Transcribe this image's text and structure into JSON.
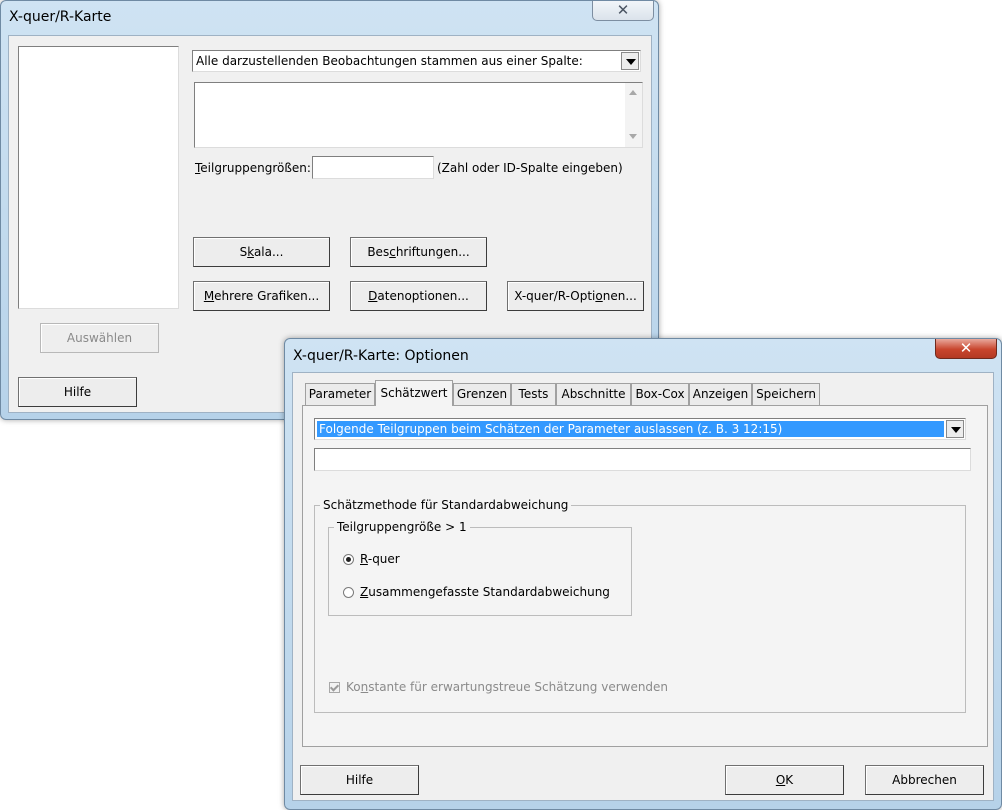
{
  "main_dialog": {
    "title": "X-quer/R-Karte",
    "close_glyph": "✕",
    "data_layout_selected": "Alle darzustellenden Beobachtungen stammen aus einer Spalte:",
    "subgroup_label_first": "T",
    "subgroup_label_rest": "eilgruppengrößen:",
    "subgroup_value": "",
    "subgroup_hint": "(Zahl oder ID-Spalte eingeben)",
    "buttons": {
      "scale_pre": "S",
      "scale_u": "k",
      "scale_post": "ala...",
      "labels_pre": "Bes",
      "labels_u": "c",
      "labels_post": "hriftungen...",
      "multi_pre": "",
      "multi_u": "M",
      "multi_post": "ehrere Grafiken...",
      "dataopt_pre": "",
      "dataopt_u": "D",
      "dataopt_post": "atenoptionen...",
      "xr_pre": "X-quer/R-Opti",
      "xr_u": "o",
      "xr_post": "nen...",
      "select": "Auswählen",
      "help": "Hilfe"
    }
  },
  "options_dialog": {
    "title": "X-quer/R-Karte: Optionen",
    "close_glyph": "✕",
    "tabs": [
      "Parameter",
      "Schätzwert",
      "Grenzen",
      "Tests",
      "Abschnitte",
      "Box-Cox",
      "Anzeigen",
      "Speichern"
    ],
    "active_tab": "Schätzwert",
    "omit_selected": "Folgende Teilgruppen beim Schätzen der Parameter auslassen (z. B. 3 12:15)",
    "omit_value": "",
    "method_group": "Schätzmethode für Standardabweichung",
    "subgroup_size_group": "Teilgruppengröße > 1",
    "radio_rbar_first": "R",
    "radio_rbar_rest": "-quer",
    "radio_rbar_selected": true,
    "radio_pooled_first": "Z",
    "radio_pooled_rest": "usammengefasste Standardabweichung",
    "checkbox_pre": "Ko",
    "checkbox_u": "n",
    "checkbox_post": "stante für erwartungstreue Schätzung verwenden",
    "checkbox_checked": true,
    "checkbox_enabled": false,
    "help": "Hilfe",
    "ok_first": "O",
    "ok_rest": "K",
    "cancel": "Abbrechen"
  },
  "colors": {
    "title_gradient_top": "#cfe3f3",
    "selection": "#3399ff",
    "close_red": "#c8452d"
  }
}
